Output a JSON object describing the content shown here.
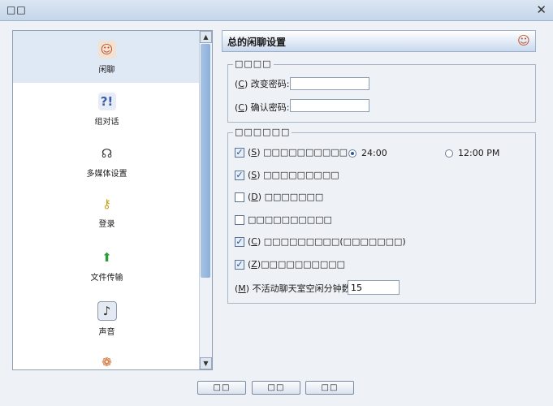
{
  "window": {
    "title": "□□"
  },
  "sidebar": {
    "items": [
      {
        "label": "闲聊",
        "icon": "user-chat-icon",
        "selected": true
      },
      {
        "label": "组对话",
        "icon": "group-chat-icon",
        "selected": false
      },
      {
        "label": "多媒体设置",
        "icon": "headset-icon",
        "selected": false
      },
      {
        "label": "登录",
        "icon": "key-icon",
        "selected": false
      },
      {
        "label": "文件传输",
        "icon": "file-transfer-icon",
        "selected": false
      },
      {
        "label": "声音",
        "icon": "sound-icon",
        "selected": false
      },
      {
        "label": "",
        "icon": "palette-icon",
        "selected": false
      }
    ]
  },
  "header": {
    "title": "总的闲聊设置",
    "icon": "user-chat-icon"
  },
  "password_group": {
    "legend": "□□□□",
    "change_password_key": "C",
    "change_password_label": "改变密码:",
    "change_password_value": "",
    "confirm_password_key": "C",
    "confirm_password_label": "确认密码:",
    "confirm_password_value": ""
  },
  "options_group": {
    "legend": "□□□□□□",
    "options": [
      {
        "key": "S",
        "label": "□□□□□□□□□□",
        "checked": true
      },
      {
        "key": "S",
        "label": "□□□□□□□□□",
        "checked": true
      },
      {
        "key": "D",
        "label": "□□□□□□□",
        "checked": false
      },
      {
        "key": "",
        "label": "□□□□□□□□□□",
        "checked": false
      },
      {
        "key": "C",
        "label": "□□□□□□□□□(□□□□□□□)",
        "checked": true
      },
      {
        "key": "Z",
        "label": "□□□□□□□□□□",
        "checked": true
      }
    ],
    "time_24": "24:00",
    "time_12": "12:00 PM",
    "time_selected": "24",
    "idle_key": "M",
    "idle_label": "不活动聊天室空闲分钟数:",
    "idle_value": "15"
  },
  "buttons": {
    "ok": "□□",
    "cancel": "□□",
    "apply": "□□"
  },
  "colors": {
    "accent": "#2d5a9c",
    "selection": "#dfe8f5",
    "border": "#8f9fb4"
  }
}
